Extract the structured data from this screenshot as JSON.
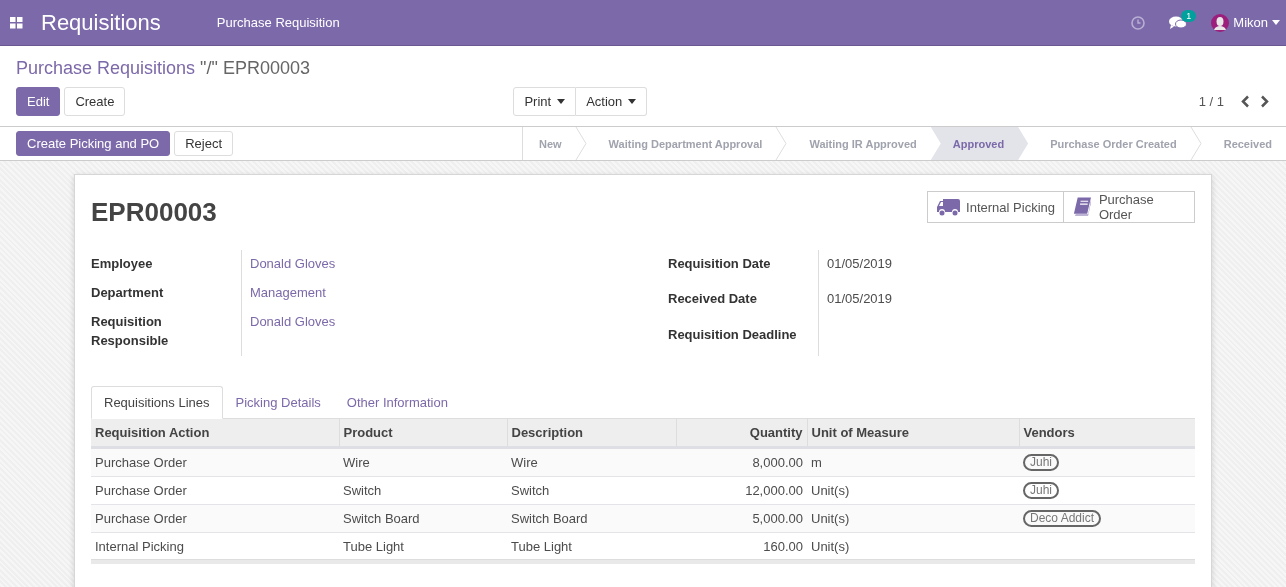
{
  "navbar": {
    "title": "Requisitions",
    "menu": [
      "Purchase Requisition"
    ],
    "chat_badge": "1",
    "user": "Mikon"
  },
  "breadcrumb": {
    "parent": "Purchase Requisitions",
    "separator": "\"/\"",
    "current": "EPR00003"
  },
  "actions": {
    "buttons": [
      {
        "label": "Edit",
        "kind": "primary"
      },
      {
        "label": "Create",
        "kind": "secondary"
      }
    ],
    "dropdowns": [
      "Print",
      "Action"
    ],
    "pager": "1 / 1"
  },
  "header_buttons": [
    {
      "label": "Create Picking and PO",
      "kind": "primary"
    },
    {
      "label": "Reject",
      "kind": "secondary"
    }
  ],
  "status_steps": [
    {
      "label": "New",
      "selected": false
    },
    {
      "label": "Waiting Department Approval",
      "selected": false
    },
    {
      "label": "Waiting IR Approved",
      "selected": false
    },
    {
      "label": "Approved",
      "selected": true
    },
    {
      "label": "Purchase Order Created",
      "selected": false
    },
    {
      "label": "Received",
      "selected": false
    }
  ],
  "sheet": {
    "title": "EPR00003",
    "smart_buttons": [
      {
        "kind": "truck",
        "label": "Internal Picking"
      },
      {
        "kind": "book",
        "label": "Purchase Order"
      }
    ],
    "fields_left": [
      {
        "label": "Employee",
        "value": "Donald Gloves"
      },
      {
        "label": "Department",
        "value": "Management"
      },
      {
        "label": "Requisition Responsible",
        "value": "Donald Gloves"
      }
    ],
    "fields_right": [
      {
        "label": "Requisition Date",
        "value": "01/05/2019"
      },
      {
        "label": "Received Date",
        "value": "01/05/2019"
      },
      {
        "label": "Requisition Deadline"
      }
    ],
    "tabs": [
      {
        "label": "Requisitions Lines",
        "selected": true
      },
      {
        "label": "Picking Details",
        "selected": false
      },
      {
        "label": "Other Information",
        "selected": false
      }
    ],
    "table": {
      "columns": [
        {
          "label": "Requisition Action",
          "kind": "text"
        },
        {
          "label": "Product",
          "kind": "text"
        },
        {
          "label": "Description",
          "kind": "text"
        },
        {
          "label": "Quantity",
          "kind": "number"
        },
        {
          "label": "Unit of Measure",
          "kind": "text"
        },
        {
          "label": "Vendors",
          "kind": "tags"
        }
      ],
      "rows": [
        {
          "cells": [
            "Purchase Order",
            "Wire",
            "Wire",
            "8,000.00",
            "m"
          ],
          "vendors": [
            "Juhi"
          ]
        },
        {
          "cells": [
            "Purchase Order",
            "Switch",
            "Switch",
            "12,000.00",
            "Unit(s)"
          ],
          "vendors": [
            "Juhi"
          ]
        },
        {
          "cells": [
            "Purchase Order",
            "Switch Board",
            "Switch Board",
            "5,000.00",
            "Unit(s)"
          ],
          "vendors": [
            "Deco Addict"
          ]
        },
        {
          "cells": [
            "Internal Picking",
            "Tube Light",
            "Tube Light",
            "160.00",
            "Unit(s)"
          ]
        }
      ]
    }
  }
}
